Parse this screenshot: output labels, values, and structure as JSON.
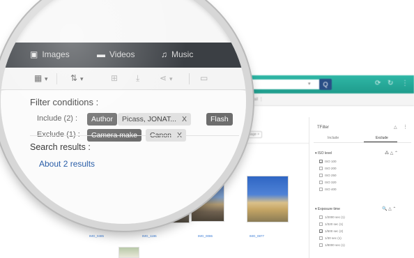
{
  "magnifier": {
    "nav": {
      "tabs": [
        {
          "label": "Images",
          "icon": "image-icon"
        },
        {
          "label": "Videos",
          "icon": "video-icon"
        },
        {
          "label": "Music",
          "icon": "music-note-icon"
        }
      ]
    },
    "toolbar": {
      "grid_caret": "▾",
      "sort_caret": "▾",
      "share_caret": "▾"
    },
    "filter": {
      "title": "Filter conditions :",
      "include_label": "Include (2) :",
      "include_chips": [
        {
          "field": "Author",
          "value": "Picass, JONAT...",
          "remove": "X"
        },
        {
          "field": "Flash"
        }
      ],
      "exclude_label": "Exclude (1) :",
      "exclude_chips": [
        {
          "field": "Camera make",
          "value": "Canon",
          "remove": "X"
        }
      ]
    },
    "results": {
      "title": "Search results :",
      "count": "About 2 results"
    }
  },
  "background": {
    "search_caret": "▾",
    "search_button": "Q",
    "top_icons": [
      "⟳",
      "↻",
      "⋮"
    ],
    "toolbar_text": "☐ Email  ⋮",
    "tag": "Image ×",
    "captions": [
      "IMG_0485",
      "IMG_1186",
      "IMG_0086",
      "IMG_0877"
    ]
  },
  "filter_panel": {
    "title": "TFilter",
    "help_icon_label": "△",
    "more_icon_label": "⋮",
    "tabs": {
      "include": "Include",
      "exclude": "Exclude"
    },
    "sections": [
      {
        "title": "▾ ISO level",
        "icons": "⁂ △ ⌃",
        "rows": [
          {
            "label": "ISO 100",
            "checked": true
          },
          {
            "label": "ISO 200",
            "checked": false
          },
          {
            "label": "ISO 250",
            "checked": false
          },
          {
            "label": "ISO 320",
            "checked": false
          },
          {
            "label": "ISO 400",
            "checked": false
          }
        ]
      },
      {
        "title": "▾ Exposure time",
        "icons": "🔍 △ ⌃",
        "rows": [
          {
            "label": "1/2000 sec (1)",
            "checked": false
          },
          {
            "label": "1/320 sec (1)",
            "checked": false
          },
          {
            "label": "1/500 sec (2)",
            "checked": true
          },
          {
            "label": "1/30 sec (1)",
            "checked": false
          },
          {
            "label": "1/8000 sec (1)",
            "checked": false
          }
        ]
      }
    ]
  },
  "colors": {
    "app_topbar": "#1f9c8c",
    "nav_dark": "#3b3f44",
    "chip_dark": "#6d6d6d",
    "link_blue": "#2a5ea8",
    "search_button": "#2a4f86"
  }
}
